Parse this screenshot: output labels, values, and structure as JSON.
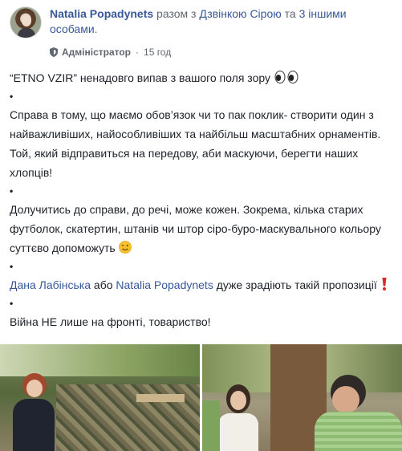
{
  "post": {
    "author": "Natalia Popadynets",
    "with_prefix": "разом з",
    "tagged_person": "Дзвінкою Сірою",
    "and_word": "та",
    "others": "3 іншими особами",
    "period": ".",
    "role": "Адміністратор",
    "separator": "·",
    "time": "15 год"
  },
  "content": {
    "p1": "“ETNO VZIR” ненадовго випав з вашого поля зору",
    "bullet": "•",
    "p2": "Справа в тому, що маємо обов’язок чи то пак поклик- створити один з найважливіших, найособливіших та найбільш масштабних орнаментів. Той, який відправиться на передову, аби маскуючи, берегти наших хлопців!",
    "p3": "Долучитись до справи, до речі, може кожен. Зокрема, кілька старих футболок, скатертин, штанів чи штор сіро-буро-маскувального кольору суттєво допоможуть",
    "p4_mention1": "Дана Лабінська",
    "p4_or": "або",
    "p4_mention2": "Natalia Popadynets",
    "p4_rest": "дуже зрадіють такій пропозиції",
    "p5": "Війна НЕ лише на фронті, товариство!"
  },
  "icons": {
    "eyes": "eyes-emoji",
    "wink": "wink-emoji",
    "exclamation": "red-exclamation-emoji",
    "shield": "admin-shield-icon"
  },
  "colors": {
    "link": "#385898",
    "text": "#1d2129",
    "meta": "#616770"
  }
}
